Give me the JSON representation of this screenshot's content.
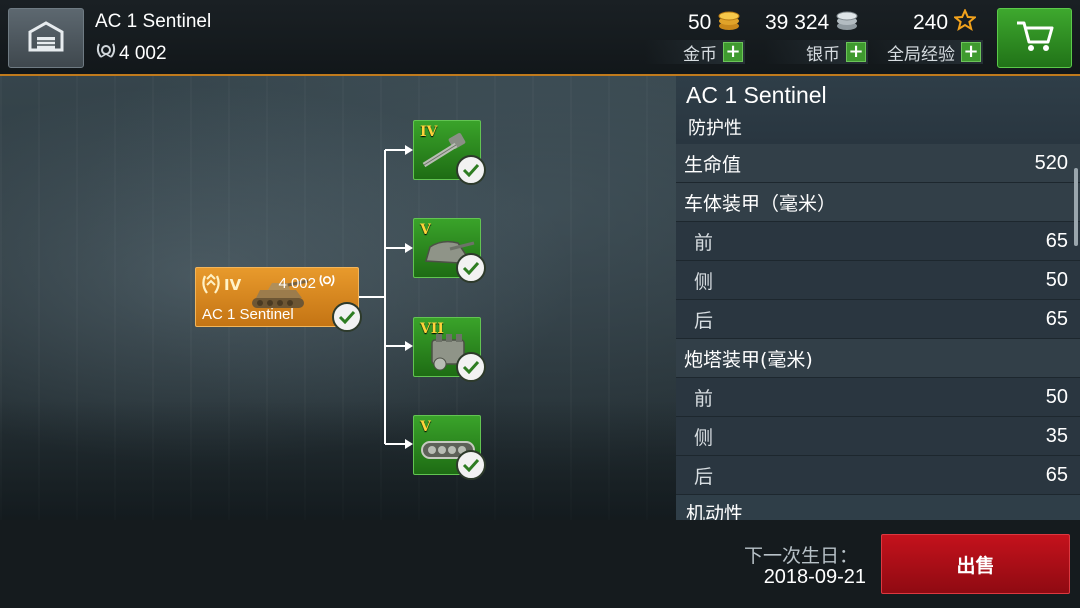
{
  "header": {
    "vehicle_name": "AC 1 Sentinel",
    "vehicle_xp": "4 002",
    "currencies": [
      {
        "value": "50",
        "label": "金币",
        "icon": "gold-coins-icon"
      },
      {
        "value": "39 324",
        "label": "银币",
        "icon": "silver-coins-icon"
      },
      {
        "value": "240",
        "label": "全局经验",
        "icon": "star-icon"
      }
    ],
    "add_symbol": "+"
  },
  "research_tree": {
    "vehicle": {
      "tier": "IV",
      "xp": "4 002",
      "name": "AC 1 Sentinel",
      "researched": true
    },
    "modules": [
      {
        "tier": "IV",
        "type": "gun",
        "icon": "gun-icon",
        "researched": true
      },
      {
        "tier": "V",
        "type": "turret",
        "icon": "turret-icon",
        "researched": true
      },
      {
        "tier": "VII",
        "type": "engine",
        "icon": "engine-icon",
        "researched": true
      },
      {
        "tier": "V",
        "type": "tracks",
        "icon": "tracks-icon",
        "researched": true
      }
    ]
  },
  "stats_panel": {
    "title": "AC 1 Sentinel",
    "section": "防护性",
    "rows": [
      {
        "label": "生命值",
        "value": "520",
        "kind": "header"
      },
      {
        "label": "车体装甲（毫米）",
        "value": "",
        "kind": "header"
      },
      {
        "label": "前",
        "value": "65",
        "kind": "sub"
      },
      {
        "label": "侧",
        "value": "50",
        "kind": "sub"
      },
      {
        "label": "后",
        "value": "65",
        "kind": "sub"
      },
      {
        "label": "炮塔装甲(毫米)",
        "value": "",
        "kind": "header"
      },
      {
        "label": "前",
        "value": "50",
        "kind": "sub"
      },
      {
        "label": "侧",
        "value": "35",
        "kind": "sub"
      },
      {
        "label": "后",
        "value": "65",
        "kind": "sub"
      }
    ],
    "next_section": "机动性"
  },
  "footer": {
    "birthday_label": "下一次生日：",
    "birthday_date": "2018-09-21",
    "sell_label": "出售"
  },
  "colors": {
    "accent_orange": "#e89a2c",
    "researched_green": "#3aa32a",
    "sell_red": "#c4121c",
    "shop_green": "#3ea82e"
  }
}
